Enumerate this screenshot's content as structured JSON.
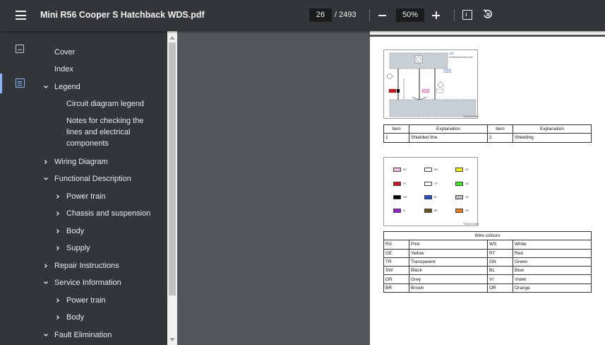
{
  "toolbar": {
    "title": "Mini R56 Cooper S Hatchback WDS.pdf",
    "current_page": "26",
    "page_total": "/ 2493",
    "zoom": "50%"
  },
  "outline": [
    {
      "label": "Cover",
      "level": 0,
      "chevron": "none"
    },
    {
      "label": "Index",
      "level": 0,
      "chevron": "none"
    },
    {
      "label": "Legend",
      "level": 0,
      "chevron": "down"
    },
    {
      "label": "Circuit diagram legend",
      "level": 1,
      "chevron": "none"
    },
    {
      "label": "Notes for checking the lines and electrical components",
      "level": 1,
      "chevron": "none"
    },
    {
      "label": "Wiring Diagram",
      "level": 0,
      "chevron": "right"
    },
    {
      "label": "Functional Description",
      "level": 0,
      "chevron": "down"
    },
    {
      "label": "Power train",
      "level": 1,
      "chevron": "right"
    },
    {
      "label": "Chassis and suspension",
      "level": 1,
      "chevron": "right"
    },
    {
      "label": "Body",
      "level": 1,
      "chevron": "right"
    },
    {
      "label": "Supply",
      "level": 1,
      "chevron": "right"
    },
    {
      "label": "Repair Instructions",
      "level": 0,
      "chevron": "right"
    },
    {
      "label": "Service Information",
      "level": 0,
      "chevron": "down"
    },
    {
      "label": "Power train",
      "level": 1,
      "chevron": "right"
    },
    {
      "label": "Body",
      "level": 1,
      "chevron": "right"
    },
    {
      "label": "Fault Elimination",
      "level": 0,
      "chevron": "down"
    }
  ],
  "page_content": {
    "fig1_labels": [
      "A367",
      "Kombinationsinstrument",
      "X10145",
      "X18742"
    ],
    "fig1_code": "TR461/31/2640",
    "fig2_code": "TR461/31/2640",
    "table1": {
      "headers": [
        "Item",
        "Explanation",
        "Item",
        "Explanation"
      ],
      "rows": [
        [
          "1",
          "Shielded line.",
          "2",
          "Shielding"
        ]
      ]
    },
    "wire_colours": {
      "title": "Wire colours",
      "rows": [
        [
          "RS",
          "Pink",
          "WS",
          "White"
        ],
        [
          "GE",
          "Yellow",
          "RT",
          "Red"
        ],
        [
          "TR",
          "Transparent",
          "GN",
          "Green"
        ],
        [
          "SW",
          "Black",
          "BL",
          "Blue"
        ],
        [
          "GR",
          "Grey",
          "VI",
          "Violet"
        ],
        [
          "BR",
          "Brown",
          "OR",
          "Orange"
        ]
      ]
    },
    "swatches": [
      {
        "code": "RS",
        "color": "#f4b8e4"
      },
      {
        "code": "WS",
        "color": "#ffffff"
      },
      {
        "code": "GE",
        "color": "#f5f000"
      },
      {
        "code": "RT",
        "color": "#d0151c"
      },
      {
        "code": "TR",
        "color": "#ffffff"
      },
      {
        "code": "GN",
        "color": "#36e81c"
      },
      {
        "code": "SW",
        "color": "#000000"
      },
      {
        "code": "BL",
        "color": "#1f4fd6"
      },
      {
        "code": "GR",
        "color": "#b9c2c8"
      },
      {
        "code": "VI",
        "color": "#9a1fd6"
      },
      {
        "code": "BR",
        "color": "#6e5412"
      },
      {
        "code": "OR",
        "color": "#f07a12"
      }
    ]
  },
  "icons": {
    "menu": "menu-icon",
    "zoom_out": "minus-icon",
    "zoom_in": "plus-icon",
    "fit": "fit-to-page-icon",
    "rotate": "rotate-icon",
    "thumbnails": "thumbnails-icon",
    "outline": "document-outline-icon"
  }
}
